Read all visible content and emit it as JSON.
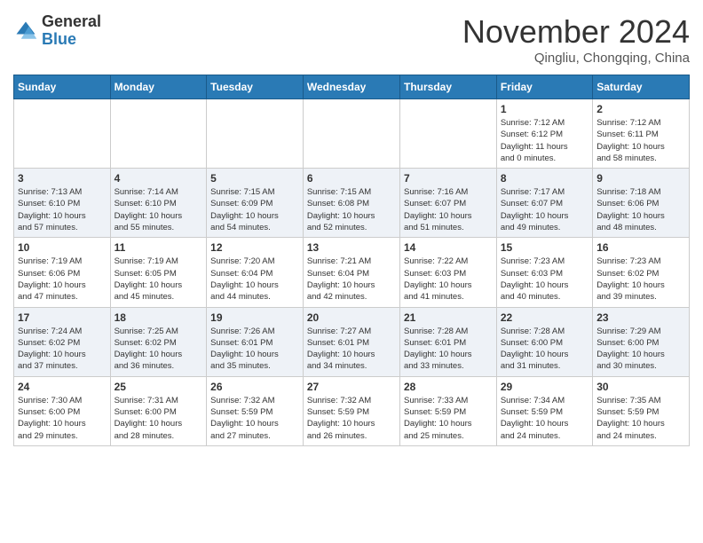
{
  "logo": {
    "general": "General",
    "blue": "Blue"
  },
  "header": {
    "month": "November 2024",
    "location": "Qingliu, Chongqing, China"
  },
  "weekdays": [
    "Sunday",
    "Monday",
    "Tuesday",
    "Wednesday",
    "Thursday",
    "Friday",
    "Saturday"
  ],
  "weeks": [
    [
      {
        "day": "",
        "info": ""
      },
      {
        "day": "",
        "info": ""
      },
      {
        "day": "",
        "info": ""
      },
      {
        "day": "",
        "info": ""
      },
      {
        "day": "",
        "info": ""
      },
      {
        "day": "1",
        "info": "Sunrise: 7:12 AM\nSunset: 6:12 PM\nDaylight: 11 hours\nand 0 minutes."
      },
      {
        "day": "2",
        "info": "Sunrise: 7:12 AM\nSunset: 6:11 PM\nDaylight: 10 hours\nand 58 minutes."
      }
    ],
    [
      {
        "day": "3",
        "info": "Sunrise: 7:13 AM\nSunset: 6:10 PM\nDaylight: 10 hours\nand 57 minutes."
      },
      {
        "day": "4",
        "info": "Sunrise: 7:14 AM\nSunset: 6:10 PM\nDaylight: 10 hours\nand 55 minutes."
      },
      {
        "day": "5",
        "info": "Sunrise: 7:15 AM\nSunset: 6:09 PM\nDaylight: 10 hours\nand 54 minutes."
      },
      {
        "day": "6",
        "info": "Sunrise: 7:15 AM\nSunset: 6:08 PM\nDaylight: 10 hours\nand 52 minutes."
      },
      {
        "day": "7",
        "info": "Sunrise: 7:16 AM\nSunset: 6:07 PM\nDaylight: 10 hours\nand 51 minutes."
      },
      {
        "day": "8",
        "info": "Sunrise: 7:17 AM\nSunset: 6:07 PM\nDaylight: 10 hours\nand 49 minutes."
      },
      {
        "day": "9",
        "info": "Sunrise: 7:18 AM\nSunset: 6:06 PM\nDaylight: 10 hours\nand 48 minutes."
      }
    ],
    [
      {
        "day": "10",
        "info": "Sunrise: 7:19 AM\nSunset: 6:06 PM\nDaylight: 10 hours\nand 47 minutes."
      },
      {
        "day": "11",
        "info": "Sunrise: 7:19 AM\nSunset: 6:05 PM\nDaylight: 10 hours\nand 45 minutes."
      },
      {
        "day": "12",
        "info": "Sunrise: 7:20 AM\nSunset: 6:04 PM\nDaylight: 10 hours\nand 44 minutes."
      },
      {
        "day": "13",
        "info": "Sunrise: 7:21 AM\nSunset: 6:04 PM\nDaylight: 10 hours\nand 42 minutes."
      },
      {
        "day": "14",
        "info": "Sunrise: 7:22 AM\nSunset: 6:03 PM\nDaylight: 10 hours\nand 41 minutes."
      },
      {
        "day": "15",
        "info": "Sunrise: 7:23 AM\nSunset: 6:03 PM\nDaylight: 10 hours\nand 40 minutes."
      },
      {
        "day": "16",
        "info": "Sunrise: 7:23 AM\nSunset: 6:02 PM\nDaylight: 10 hours\nand 39 minutes."
      }
    ],
    [
      {
        "day": "17",
        "info": "Sunrise: 7:24 AM\nSunset: 6:02 PM\nDaylight: 10 hours\nand 37 minutes."
      },
      {
        "day": "18",
        "info": "Sunrise: 7:25 AM\nSunset: 6:02 PM\nDaylight: 10 hours\nand 36 minutes."
      },
      {
        "day": "19",
        "info": "Sunrise: 7:26 AM\nSunset: 6:01 PM\nDaylight: 10 hours\nand 35 minutes."
      },
      {
        "day": "20",
        "info": "Sunrise: 7:27 AM\nSunset: 6:01 PM\nDaylight: 10 hours\nand 34 minutes."
      },
      {
        "day": "21",
        "info": "Sunrise: 7:28 AM\nSunset: 6:01 PM\nDaylight: 10 hours\nand 33 minutes."
      },
      {
        "day": "22",
        "info": "Sunrise: 7:28 AM\nSunset: 6:00 PM\nDaylight: 10 hours\nand 31 minutes."
      },
      {
        "day": "23",
        "info": "Sunrise: 7:29 AM\nSunset: 6:00 PM\nDaylight: 10 hours\nand 30 minutes."
      }
    ],
    [
      {
        "day": "24",
        "info": "Sunrise: 7:30 AM\nSunset: 6:00 PM\nDaylight: 10 hours\nand 29 minutes."
      },
      {
        "day": "25",
        "info": "Sunrise: 7:31 AM\nSunset: 6:00 PM\nDaylight: 10 hours\nand 28 minutes."
      },
      {
        "day": "26",
        "info": "Sunrise: 7:32 AM\nSunset: 5:59 PM\nDaylight: 10 hours\nand 27 minutes."
      },
      {
        "day": "27",
        "info": "Sunrise: 7:32 AM\nSunset: 5:59 PM\nDaylight: 10 hours\nand 26 minutes."
      },
      {
        "day": "28",
        "info": "Sunrise: 7:33 AM\nSunset: 5:59 PM\nDaylight: 10 hours\nand 25 minutes."
      },
      {
        "day": "29",
        "info": "Sunrise: 7:34 AM\nSunset: 5:59 PM\nDaylight: 10 hours\nand 24 minutes."
      },
      {
        "day": "30",
        "info": "Sunrise: 7:35 AM\nSunset: 5:59 PM\nDaylight: 10 hours\nand 24 minutes."
      }
    ]
  ]
}
